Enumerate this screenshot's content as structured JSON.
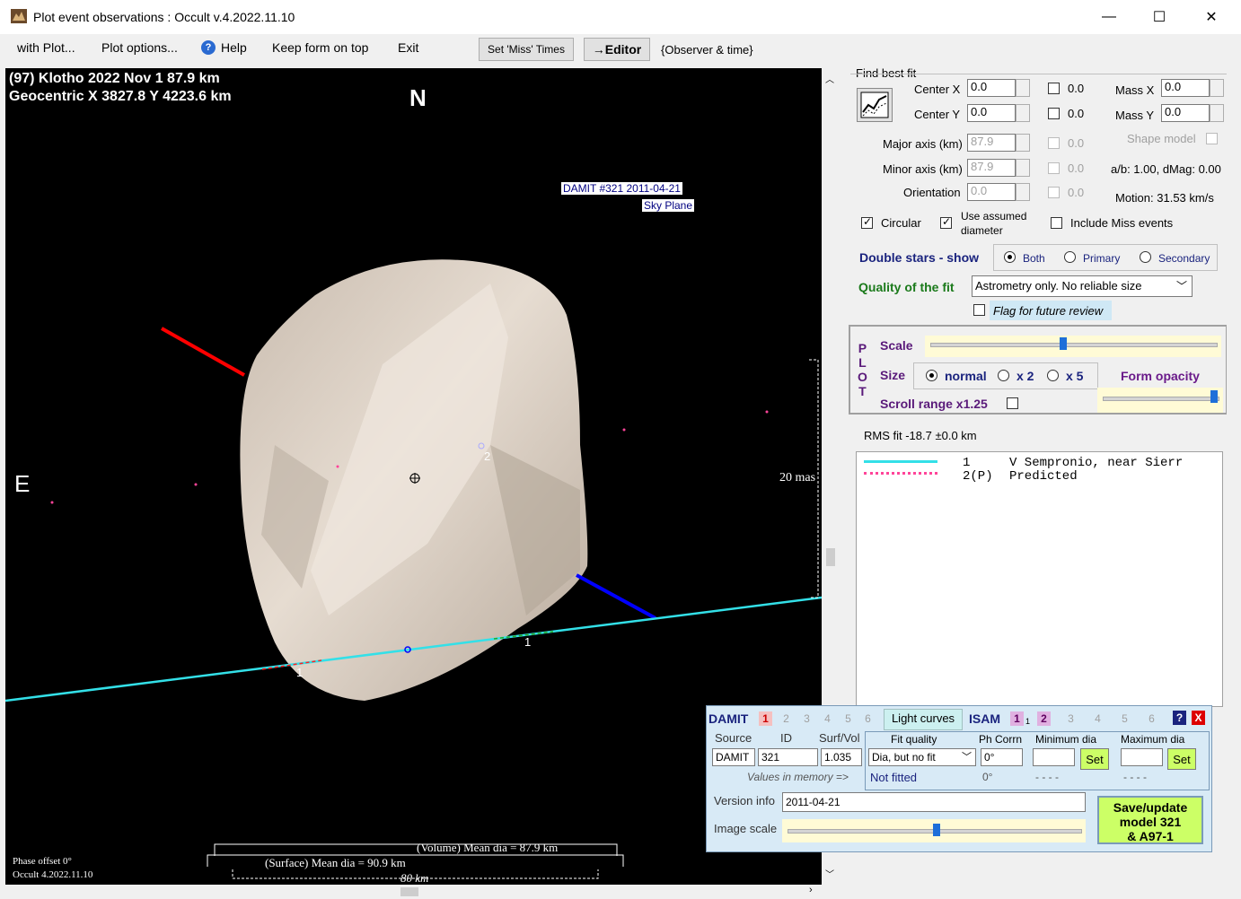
{
  "window": {
    "title": "Plot event observations : Occult v.4.2022.11.10",
    "minimize": "—",
    "maximize": "☐",
    "close": "✕"
  },
  "menu": {
    "with_plot": "with Plot...",
    "plot_options": "Plot options...",
    "help": "Help",
    "keep_on_top": "Keep form on top",
    "exit": "Exit",
    "set_miss_times": "Set 'Miss' Times",
    "editor": "→Editor",
    "observer_time": "{Observer & time}"
  },
  "plot": {
    "header_line1": "(97) Klotho  2022 Nov 1   87.9 km",
    "header_line2": "Geocentric  X  3827.8  Y 4223.6 km",
    "north": "N",
    "east": "E",
    "damit_label1": "DAMIT #321 2011-04-21",
    "damit_label2": "Sky Plane",
    "scale_mas": "20 mas",
    "chord_label1a": "1",
    "chord_label1b": "1",
    "chord_label2": "2",
    "volume_dia": "(Volume) Mean dia = 87.9 km",
    "surface_dia": "(Surface) Mean dia = 90.9 km",
    "km_scale": "80 km",
    "phase_offset": "Phase offset 0°",
    "version": "Occult 4.2022.11.10"
  },
  "fit": {
    "title": "Find best fit",
    "center_x_label": "Center X",
    "center_x": "0.0",
    "center_y_label": "Center Y",
    "center_y": "0.0",
    "center_x_chk": "0.0",
    "center_y_chk": "0.0",
    "mass_x_label": "Mass X",
    "mass_x": "0.0",
    "mass_y_label": "Mass Y",
    "mass_y": "0.0",
    "major_label": "Major axis (km)",
    "major": "87.9",
    "minor_label": "Minor axis (km)",
    "minor": "87.9",
    "orient_label": "Orientation",
    "orient": "0.0",
    "major_chk": "0.0",
    "minor_chk": "0.0",
    "orient_chk": "0.0",
    "shape_model": "Shape model",
    "ab_dmag": "a/b: 1.00, dMag: 0.00",
    "motion": "Motion: 31.53 km/s",
    "circular": "Circular",
    "use_assumed_1": "Use assumed",
    "use_assumed_2": "diameter",
    "include_miss": "Include Miss events",
    "double_stars": "Double stars - show",
    "both": "Both",
    "primary": "Primary",
    "secondary": "Secondary",
    "quality_label": "Quality of the fit",
    "quality_value": "Astrometry only. No reliable size",
    "flag_review": "Flag for future review"
  },
  "plotbox": {
    "p_letters": [
      "P",
      "L",
      "O",
      "T"
    ],
    "scale": "Scale",
    "size": "Size",
    "normal": "normal",
    "x2": "x 2",
    "x5": "x 5",
    "form_opacity": "Form opacity",
    "scroll_range": "Scroll range x1.25"
  },
  "rms": "RMS fit -18.7 ±0.0 km",
  "legend": {
    "row1_num": "1",
    "row1_text": "V Sempronio, near Sierr",
    "row2_num": "2(P)",
    "row2_text": "Predicted"
  },
  "damit": {
    "damit": "DAMIT",
    "nums": [
      "1",
      "2",
      "3",
      "4",
      "5",
      "6"
    ],
    "light_curves": "Light curves",
    "isam": "ISAM",
    "isam_nums": [
      "1",
      "1",
      "2",
      "3",
      "4",
      "5",
      "6"
    ],
    "help": "?",
    "close": "X",
    "source_h": "Source",
    "id_h": "ID",
    "surfvol_h": "Surf/Vol",
    "fitq_h": "Fit quality",
    "phcorr_h": "Ph Corrn",
    "mindia_h": "Minimum dia",
    "maxdia_h": "Maximum dia",
    "source": "DAMIT",
    "id": "321",
    "surfvol": "1.035",
    "fitq": "Dia, but no fit",
    "phcorr": "0°",
    "set": "Set",
    "set2": "Set",
    "mem_label": "Values in memory =>",
    "mem_fit": "Not fitted",
    "mem_ph": "0°",
    "mem_min": "- - - -",
    "mem_max": "- - - -",
    "version_label": "Version info",
    "version": "2011-04-21",
    "image_scale": "Image scale",
    "save_1": "Save/update",
    "save_2": "model 321",
    "save_3": "& A97-1"
  }
}
